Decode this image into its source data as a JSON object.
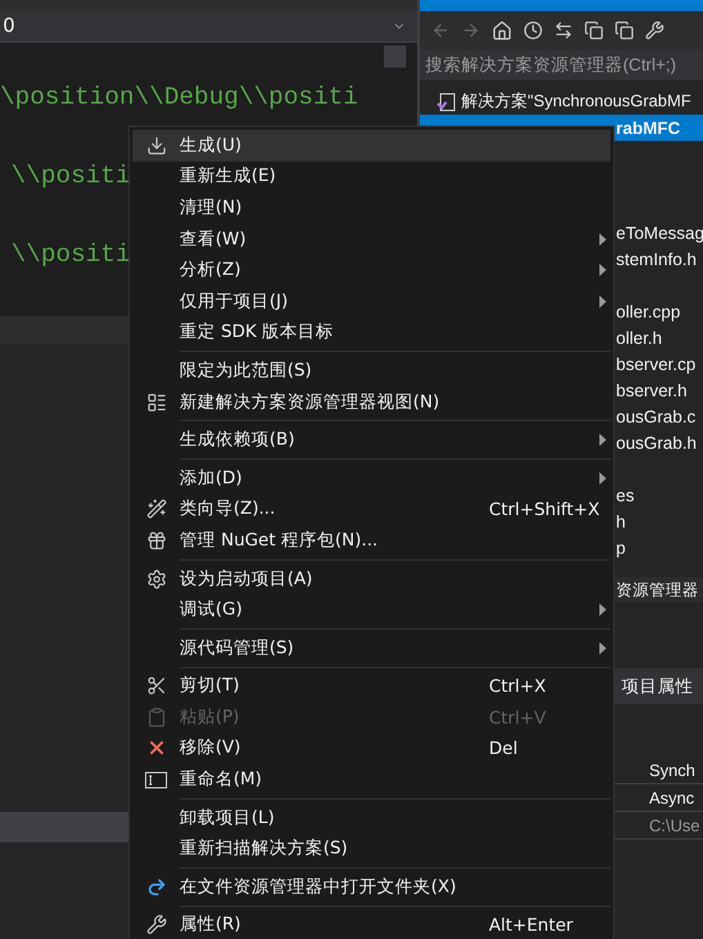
{
  "editor": {
    "dropdown_value": "0",
    "code_lines": [
      "\\position\\\\Debug\\\\positi",
      "\\\\positi",
      "\\\\positi"
    ]
  },
  "solution_explorer": {
    "search": {
      "placeholder": "搜索解决方案资源管理器(Ctrl+;)"
    },
    "solution_row": "解决方案\"SynchronousGrabMF",
    "project_row": {
      "text": "rabMFC",
      "selected": true
    },
    "tree_fragments": [
      [
        "eToMessag",
        "stemInfo.h"
      ],
      [
        "oller.cpp",
        "oller.h",
        "bserver.cp",
        "bserver.h",
        "ousGrab.c",
        "ousGrab.h"
      ],
      [
        "es",
        "h",
        "p"
      ]
    ]
  },
  "lower_tab": "资源管理器",
  "properties": {
    "toolbar_label": "项目属性",
    "cells": [
      "Synch",
      "Async",
      "C:\\Use"
    ]
  },
  "context_menu": [
    [
      {
        "label": "生成(U)",
        "kind": "build",
        "selected": true,
        "submenu": false,
        "disabled": false
      },
      {
        "label": "重新生成(E)",
        "selected": false,
        "submenu": false,
        "disabled": false
      },
      {
        "label": "清理(N)",
        "selected": false,
        "submenu": false,
        "disabled": false
      },
      {
        "label": "查看(W)",
        "selected": false,
        "submenu": true,
        "disabled": false
      },
      {
        "label": "分析(Z)",
        "selected": false,
        "submenu": true,
        "disabled": false
      },
      {
        "label": "仅用于项目(J)",
        "selected": false,
        "submenu": true,
        "disabled": false
      },
      {
        "label": "重定 SDK 版本目标",
        "selected": false,
        "submenu": false,
        "disabled": false
      }
    ],
    [
      {
        "label": "限定为此范围(S)",
        "selected": false,
        "submenu": false,
        "disabled": false
      },
      {
        "label": "新建解决方案资源管理器视图(N)",
        "kind": "newview",
        "selected": false,
        "submenu": false,
        "disabled": false
      }
    ],
    [
      {
        "label": "生成依赖项(B)",
        "selected": false,
        "submenu": true,
        "disabled": false
      }
    ],
    [
      {
        "label": "添加(D)",
        "selected": false,
        "submenu": true,
        "disabled": false
      },
      {
        "label": "类向导(Z)...",
        "kind": "wizard",
        "shortcut": "Ctrl+Shift+X",
        "selected": false,
        "submenu": false,
        "disabled": false
      },
      {
        "label": "管理 NuGet 程序包(N)...",
        "kind": "package",
        "selected": false,
        "submenu": false,
        "disabled": false
      }
    ],
    [
      {
        "label": "设为启动项目(A)",
        "kind": "gear",
        "selected": false,
        "submenu": false,
        "disabled": false
      },
      {
        "label": "调试(G)",
        "selected": false,
        "submenu": true,
        "disabled": false
      }
    ],
    [
      {
        "label": "源代码管理(S)",
        "selected": false,
        "submenu": true,
        "disabled": false
      }
    ],
    [
      {
        "label": "剪切(T)",
        "kind": "cut",
        "shortcut": "Ctrl+X",
        "selected": false,
        "submenu": false,
        "disabled": false
      },
      {
        "label": "粘贴(P)",
        "kind": "paste",
        "shortcut": "Ctrl+V",
        "selected": false,
        "submenu": false,
        "disabled": true
      },
      {
        "label": "移除(V)",
        "kind": "remove",
        "shortcut": "Del",
        "selected": false,
        "submenu": false,
        "disabled": false
      },
      {
        "label": "重命名(M)",
        "kind": "rename",
        "selected": false,
        "submenu": false,
        "disabled": false
      }
    ],
    [
      {
        "label": "卸载项目(L)",
        "selected": false,
        "submenu": false,
        "disabled": false
      },
      {
        "label": "重新扫描解决方案(S)",
        "selected": false,
        "submenu": false,
        "disabled": false
      }
    ],
    [
      {
        "label": "在文件资源管理器中打开文件夹(X)",
        "kind": "open",
        "selected": false,
        "submenu": false,
        "disabled": false
      }
    ],
    [
      {
        "label": "属性(R)",
        "kind": "wrench",
        "shortcut": "Alt+Enter",
        "selected": false,
        "submenu": false,
        "disabled": false
      }
    ]
  ]
}
